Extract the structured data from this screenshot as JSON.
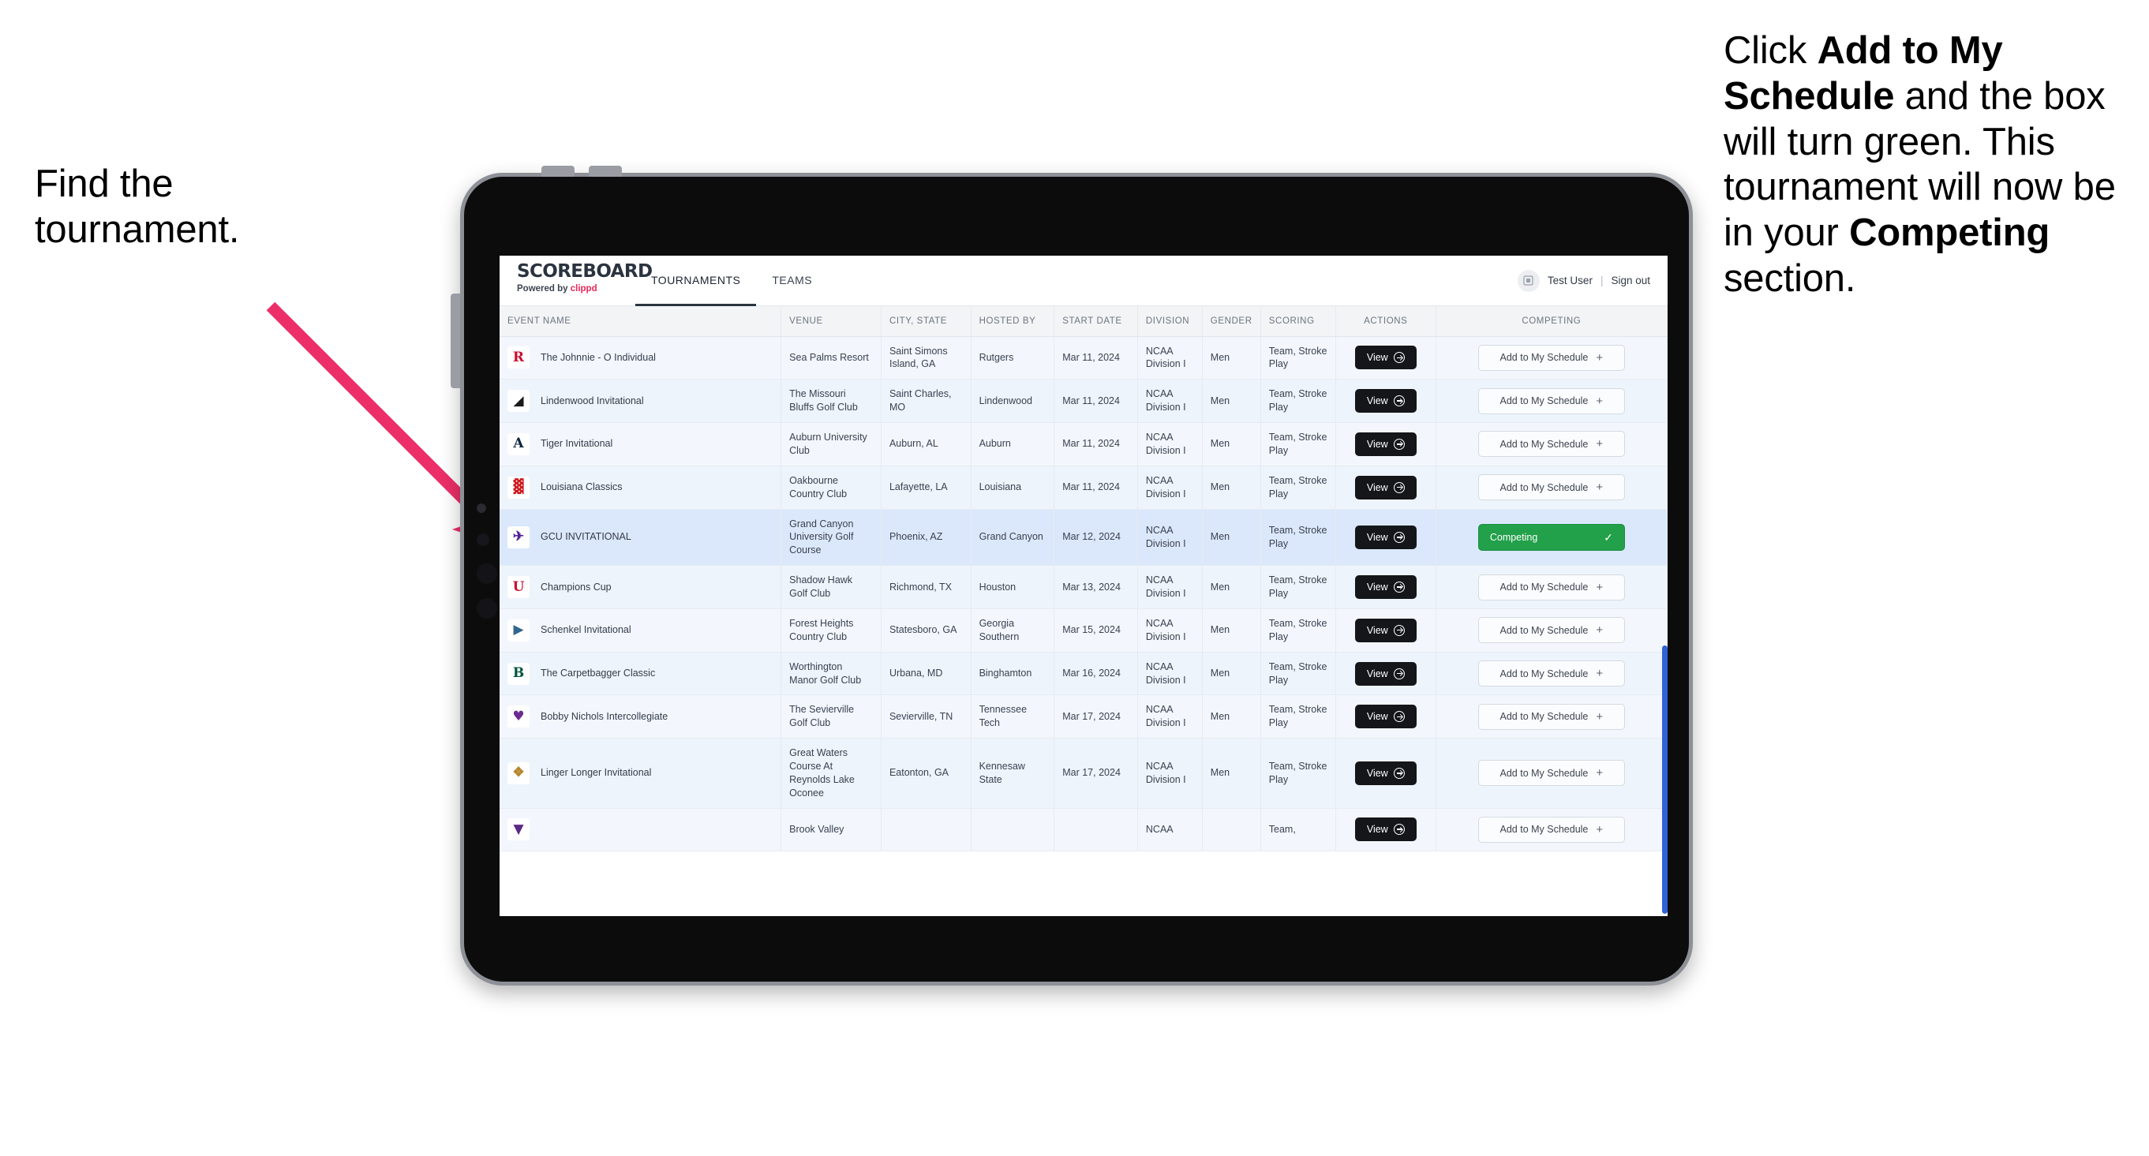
{
  "annotations": {
    "left": "Find the tournament.",
    "right_html": "Click <b>Add to My Schedule</b> and the box will turn green. This tournament will now be in your <b>Competing</b> section.",
    "arrow_color": "#ec2f68"
  },
  "app": {
    "brand_title": "SCOREBOARD",
    "brand_sub_prefix": "Powered by ",
    "brand_sub_name": "clippd",
    "tabs": [
      {
        "label": "TOURNAMENTS",
        "active": true
      },
      {
        "label": "TEAMS",
        "active": false
      }
    ],
    "user": {
      "avatar_icon": "user-grid-icon",
      "name": "Test User",
      "separator": "|",
      "sign_out": "Sign out"
    }
  },
  "table": {
    "columns": [
      "EVENT NAME",
      "VENUE",
      "CITY, STATE",
      "HOSTED BY",
      "START DATE",
      "DIVISION",
      "GENDER",
      "SCORING",
      "ACTIONS",
      "COMPETING"
    ],
    "action_label": "View",
    "add_label": "Add to My Schedule",
    "competing_label": "Competing",
    "rows": [
      {
        "logo_text": "R",
        "logo_bg": "#ffffff",
        "logo_fg": "#c8102e",
        "event": "The Johnnie - O Individual",
        "venue": "Sea Palms Resort",
        "city": "Saint Simons Island, GA",
        "host": "Rutgers",
        "date": "Mar 11, 2024",
        "division": "NCAA Division I",
        "gender": "Men",
        "scoring": "Team, Stroke Play",
        "competing": false
      },
      {
        "logo_text": "◢",
        "logo_bg": "#ffffff",
        "logo_fg": "#1a1a1a",
        "event": "Lindenwood Invitational",
        "venue": "The Missouri Bluffs Golf Club",
        "city": "Saint Charles, MO",
        "host": "Lindenwood",
        "date": "Mar 11, 2024",
        "division": "NCAA Division I",
        "gender": "Men",
        "scoring": "Team, Stroke Play",
        "competing": false
      },
      {
        "logo_text": "A",
        "logo_bg": "#ffffff",
        "logo_fg": "#0c2340",
        "event": "Tiger Invitational",
        "venue": "Auburn University Club",
        "city": "Auburn, AL",
        "host": "Auburn",
        "date": "Mar 11, 2024",
        "division": "NCAA Division I",
        "gender": "Men",
        "scoring": "Team, Stroke Play",
        "competing": false
      },
      {
        "logo_text": "▓",
        "logo_bg": "#ffffff",
        "logo_fg": "#ce181e",
        "event": "Louisiana Classics",
        "venue": "Oakbourne Country Club",
        "city": "Lafayette, LA",
        "host": "Louisiana",
        "date": "Mar 11, 2024",
        "division": "NCAA Division I",
        "gender": "Men",
        "scoring": "Team, Stroke Play",
        "competing": false
      },
      {
        "logo_text": "✈",
        "logo_bg": "#ffffff",
        "logo_fg": "#522398",
        "event": "GCU INVITATIONAL",
        "venue": "Grand Canyon University Golf Course",
        "city": "Phoenix, AZ",
        "host": "Grand Canyon",
        "date": "Mar 12, 2024",
        "division": "NCAA Division I",
        "gender": "Men",
        "scoring": "Team, Stroke Play",
        "competing": true,
        "selected": true
      },
      {
        "logo_text": "U",
        "logo_bg": "#ffffff",
        "logo_fg": "#c8102e",
        "event": "Champions Cup",
        "venue": "Shadow Hawk Golf Club",
        "city": "Richmond, TX",
        "host": "Houston",
        "date": "Mar 13, 2024",
        "division": "NCAA Division I",
        "gender": "Men",
        "scoring": "Team, Stroke Play",
        "competing": false
      },
      {
        "logo_text": "▶",
        "logo_bg": "#ffffff",
        "logo_fg": "#31678f",
        "event": "Schenkel Invitational",
        "venue": "Forest Heights Country Club",
        "city": "Statesboro, GA",
        "host": "Georgia Southern",
        "date": "Mar 15, 2024",
        "division": "NCAA Division I",
        "gender": "Men",
        "scoring": "Team, Stroke Play",
        "competing": false
      },
      {
        "logo_text": "B",
        "logo_bg": "#ffffff",
        "logo_fg": "#00553e",
        "event": "The Carpetbagger Classic",
        "venue": "Worthington Manor Golf Club",
        "city": "Urbana, MD",
        "host": "Binghamton",
        "date": "Mar 16, 2024",
        "division": "NCAA Division I",
        "gender": "Men",
        "scoring": "Team, Stroke Play",
        "competing": false
      },
      {
        "logo_text": "♥",
        "logo_bg": "#ffffff",
        "logo_fg": "#6a2c8f",
        "event": "Bobby Nichols Intercollegiate",
        "venue": "The Sevierville Golf Club",
        "city": "Sevierville, TN",
        "host": "Tennessee Tech",
        "date": "Mar 17, 2024",
        "division": "NCAA Division I",
        "gender": "Men",
        "scoring": "Team, Stroke Play",
        "competing": false
      },
      {
        "logo_text": "❖",
        "logo_bg": "#ffffff",
        "logo_fg": "#b6862c",
        "event": "Linger Longer Invitational",
        "venue": "Great Waters Course At Reynolds Lake Oconee",
        "city": "Eatonton, GA",
        "host": "Kennesaw State",
        "date": "Mar 17, 2024",
        "division": "NCAA Division I",
        "gender": "Men",
        "scoring": "Team, Stroke Play",
        "competing": false
      },
      {
        "logo_text": "▼",
        "logo_bg": "#ffffff",
        "logo_fg": "#5b2b82",
        "event": "",
        "venue": "Brook Valley",
        "city": "",
        "host": "",
        "date": "",
        "division": "NCAA",
        "gender": "",
        "scoring": "Team,",
        "competing": false,
        "clipped": true
      }
    ]
  }
}
